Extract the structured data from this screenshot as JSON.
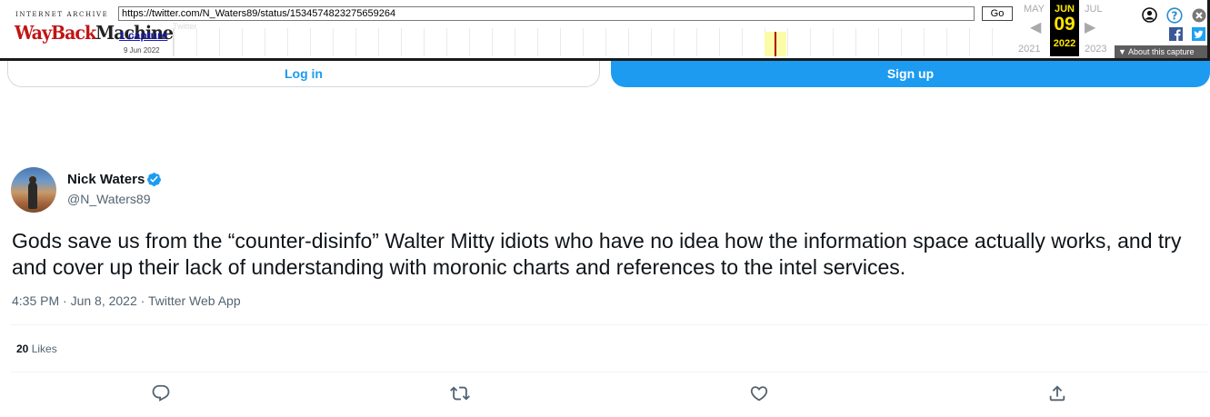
{
  "wayback": {
    "logo_top": "INTERNET ARCHIVE",
    "logo_wayback": "WayBack",
    "logo_machine": "Machine",
    "url": "https://twitter.com/N_Waters89/status/1534574823275659264",
    "go_label": "Go",
    "captures_label": "1 capture",
    "capture_date": "9 Jun 2022",
    "faded_text": "Twitter",
    "prev_month": "MAY",
    "current_month": "JUN",
    "next_month": "JUL",
    "prev_year": "2021",
    "current_day": "09",
    "current_year": "2022",
    "next_year": "2023",
    "about_label": "About this capture",
    "accent_color": "#c01515",
    "current_color": "#ffe600"
  },
  "auth": {
    "login_label": "Log in",
    "signup_label": "Sign up",
    "brand_color": "#1d9bf0"
  },
  "tweet": {
    "display_name": "Nick Waters",
    "handle": "@N_Waters89",
    "verified": true,
    "text": "Gods save us from the “counter-disinfo” Walter Mitty idiots who have no idea how the information space actually works, and try and cover up their lack of understanding with moronic charts and references to the intel services.",
    "meta": "4:35 PM · Jun 8, 2022 · Twitter Web App",
    "likes_count": "20",
    "likes_label": "Likes"
  },
  "actions": [
    "reply-icon",
    "retweet-icon",
    "like-icon",
    "share-icon"
  ]
}
